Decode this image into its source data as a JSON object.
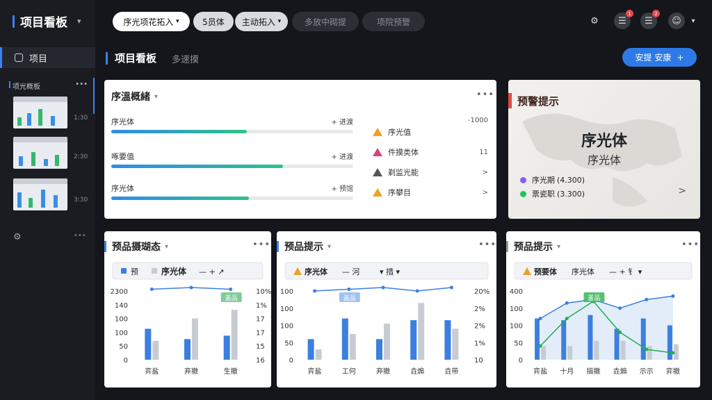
{
  "app": {
    "title": "项目看板"
  },
  "sidebar": {
    "nav_item": "项目",
    "section_label": "项光概板",
    "section_more": "•••",
    "thumbs": [
      {
        "num": "1:30"
      },
      {
        "num": "2:30"
      },
      {
        "num": "3:30"
      }
    ],
    "dots": "•••"
  },
  "topbar": {
    "chips": [
      "序光项花拓入",
      "5员体",
      "主动拓入",
      "多放中砌提",
      "项院预警"
    ]
  },
  "page": {
    "title": "项目看板",
    "subtitle": "多速摸",
    "primary_button": "安提  安康",
    "primary_button_icon": "+"
  },
  "progress_panel": {
    "title": "序溫概緒",
    "rows": [
      {
        "label": "序光体",
        "right": "+ 进渡",
        "fill": 0.56
      },
      {
        "label": "啄要值",
        "right": "+ 进渡",
        "fill": 0.71
      },
      {
        "label": "序光体",
        "right": "+ 预馆",
        "fill": 0.57
      }
    ],
    "warnings": [
      {
        "label": "序光值",
        "value": "-1000",
        "color": "orange"
      },
      {
        "label": "件摸类体",
        "value": "11",
        "color": "pink"
      },
      {
        "label": "剃监光能",
        "value": ">",
        "color": "gray"
      },
      {
        "label": "序攀目",
        "value": ">",
        "color": "orange"
      }
    ]
  },
  "alert": {
    "title": "预警提示",
    "big": "序光体",
    "mid": "序光体",
    "legend": [
      {
        "label": "序光期",
        "pct": "(4.300)",
        "color": "#8b5cf6"
      },
      {
        "label": "票瓷职",
        "pct": "(3.300)",
        "color": "#22c55e"
      }
    ],
    "chev": ">"
  },
  "charts": [
    {
      "title": "预品摄瑚态",
      "toolbar": [
        "预",
        "序光体",
        "— + ↗"
      ],
      "chart_data": {
        "type": "bar",
        "categories": [
          "弈盐",
          "弃撤",
          "生撤"
        ],
        "series": [
          {
            "values": [
              90,
              60,
              70
            ],
            "color": "#3b7fe0"
          },
          {
            "values": [
              55,
              120,
              145
            ],
            "color": "#c8ccd2"
          }
        ],
        "line": [
          205,
          210,
          205
        ],
        "yticks_left": [
          "2300",
          "140",
          "100",
          "100",
          "50",
          "0"
        ],
        "yticks_right": [
          "10%",
          "1%",
          "17",
          "17",
          "15",
          "16"
        ],
        "tag": "盖品"
      }
    },
    {
      "title": "预品提示",
      "toolbar": [
        "序光体",
        "— 河",
        "▾ 措 ▾"
      ],
      "chart_data": {
        "type": "bar",
        "categories": [
          "弈盐",
          "工何",
          "弃撤",
          "垚煽",
          "垚带"
        ],
        "series": [
          {
            "values": [
              60,
              120,
              60,
              115,
              115
            ],
            "color": "#3b7fe0"
          },
          {
            "values": [
              30,
              75,
              105,
              165,
              90
            ],
            "color": "#c8ccd2"
          }
        ],
        "line": [
          200,
          205,
          210,
          200,
          210
        ],
        "yticks_left": [
          "100",
          "100",
          "100",
          "50",
          "0"
        ],
        "yticks_right": [
          "20%",
          "2%",
          "2%",
          "1%",
          "10"
        ],
        "tag": "盖品"
      }
    },
    {
      "title": "预品提示",
      "toolbar": [
        "预要体",
        "序光体",
        "— + 钅 ▾"
      ],
      "chart_data": {
        "type": "bar",
        "categories": [
          "弈盐",
          "十月",
          "描撤",
          "垚煽",
          "示示",
          "弈撤"
        ],
        "series": [
          {
            "values": [
              120,
              115,
              130,
              90,
              120,
              100
            ],
            "color": "#3b7fe0"
          },
          {
            "values": [
              40,
              40,
              55,
              55,
              40,
              45
            ],
            "color": "#c8ccd2"
          }
        ],
        "line": [
          120,
          165,
          175,
          150,
          175,
          185
        ],
        "yticks_left": [
          "400",
          "100",
          "100",
          "50",
          "0"
        ],
        "tag": "盖品"
      }
    }
  ]
}
